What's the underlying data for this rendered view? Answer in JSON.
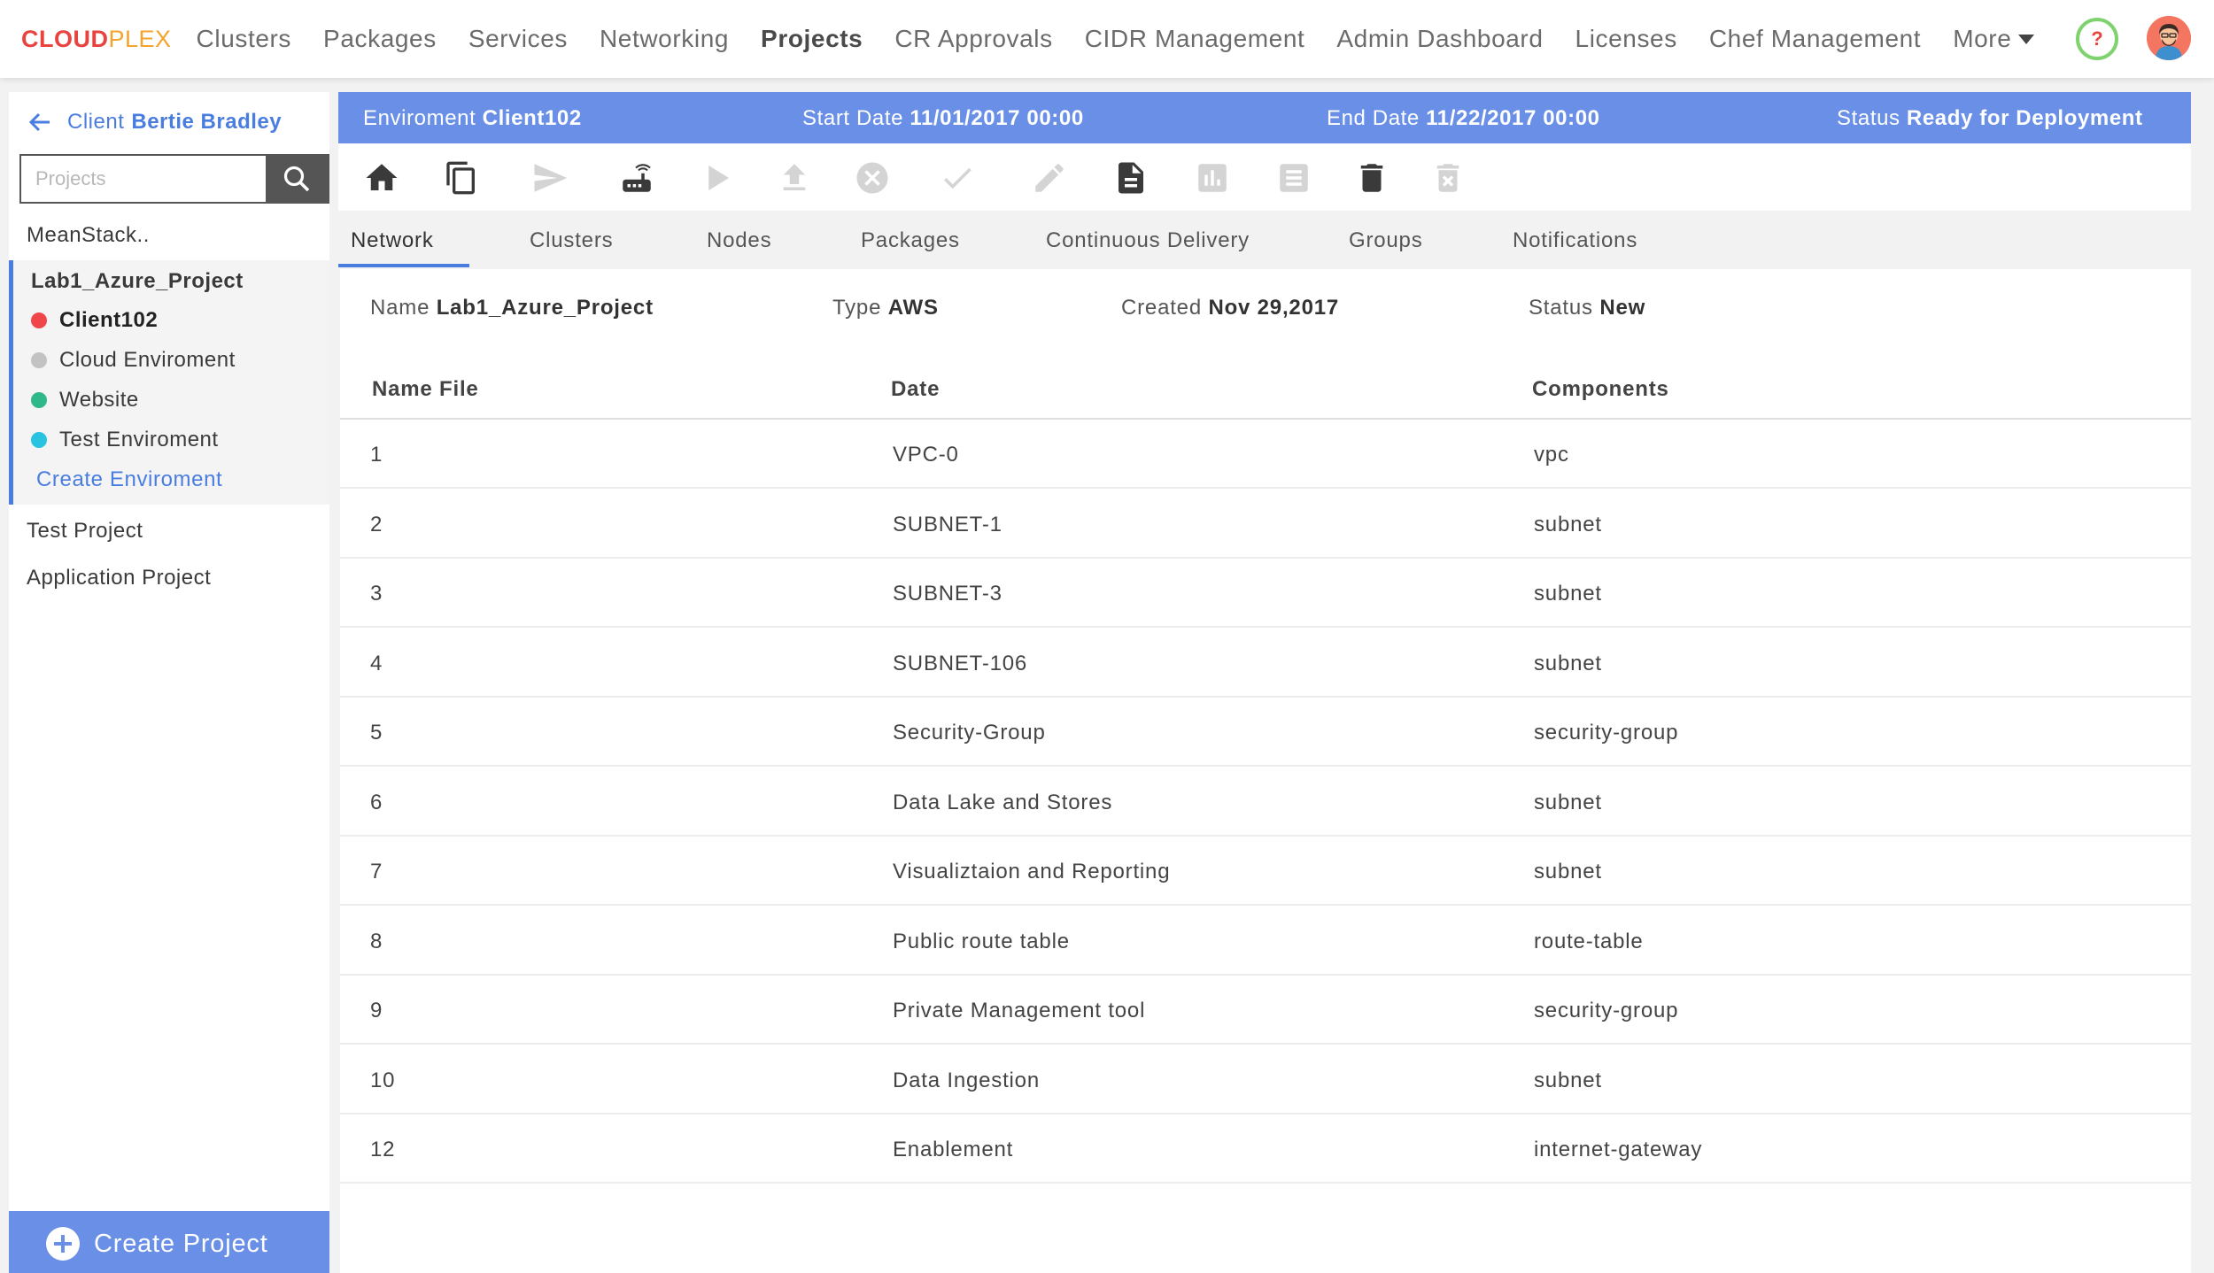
{
  "app": {
    "logo_part1": "CLOUD",
    "logo_part2": "PLEX"
  },
  "topnav": {
    "items": [
      {
        "label": "Clusters"
      },
      {
        "label": "Packages"
      },
      {
        "label": "Services"
      },
      {
        "label": "Networking"
      },
      {
        "label": "Projects",
        "active": true
      },
      {
        "label": "CR Approvals"
      },
      {
        "label": "CIDR Management"
      },
      {
        "label": "Admin Dashboard"
      },
      {
        "label": "Licenses"
      },
      {
        "label": "Chef Management"
      }
    ],
    "more_label": "More",
    "help_label": "?"
  },
  "sidebar": {
    "client_prefix": "Client",
    "client_name": "Bertie Bradley",
    "search_placeholder": "Projects",
    "projects_top": [
      "MeanStack.."
    ],
    "current_project": "Lab1_Azure_Project",
    "environments": [
      {
        "label": "Client102",
        "color": "#f0464a",
        "active": true
      },
      {
        "label": "Cloud Enviroment",
        "color": "#c2c2c2"
      },
      {
        "label": "Website",
        "color": "#2fb889"
      },
      {
        "label": "Test Enviroment",
        "color": "#27c3e0"
      }
    ],
    "create_env_label": "Create Enviroment",
    "projects_bottom": [
      "Test Project",
      "Application Project"
    ],
    "create_project_label": "Create Project"
  },
  "env_header": {
    "env_label": "Enviroment",
    "env_value": "Client102",
    "start_label": "Start Date",
    "start_value": "11/01/2017 00:00",
    "end_label": "End Date",
    "end_value": "11/22/2017 00:00",
    "status_label": "Status",
    "status_value": "Ready for Deployment"
  },
  "toolbar": {
    "icons": [
      "home-icon",
      "copy-icon",
      "send-icon",
      "router-icon",
      "play-icon",
      "upload-icon",
      "cancel-icon",
      "check-icon",
      "edit-icon",
      "document-icon",
      "chart-icon",
      "list-icon",
      "delete-icon",
      "delete-x-icon"
    ]
  },
  "tabs": [
    {
      "label": "Network",
      "active": true
    },
    {
      "label": "Clusters"
    },
    {
      "label": "Nodes"
    },
    {
      "label": "Packages"
    },
    {
      "label": "Continuous Delivery"
    },
    {
      "label": "Groups"
    },
    {
      "label": "Notifications"
    }
  ],
  "project_meta": {
    "name_label": "Name",
    "name_value": "Lab1_Azure_Project",
    "type_label": "Type",
    "type_value": "AWS",
    "created_label": "Created",
    "created_value": "Nov 29,2017",
    "status_label": "Status",
    "status_value": "New"
  },
  "table": {
    "columns": [
      "Name File",
      "Date",
      "Components"
    ],
    "rows": [
      [
        "1",
        "VPC-0",
        "vpc"
      ],
      [
        "2",
        "SUBNET-1",
        "subnet"
      ],
      [
        "3",
        "SUBNET-3",
        "subnet"
      ],
      [
        "4",
        "SUBNET-106",
        "subnet"
      ],
      [
        "5",
        "Security-Group",
        "security-group"
      ],
      [
        "6",
        "Data Lake and Stores",
        "subnet"
      ],
      [
        "7",
        "Visualiztaion and Reporting",
        "subnet"
      ],
      [
        "8",
        "Public route table",
        "route-table"
      ],
      [
        "9",
        "Private Management tool",
        "security-group"
      ],
      [
        "10",
        "Data Ingestion",
        "subnet"
      ],
      [
        "12",
        "Enablement",
        "internet-gateway"
      ]
    ]
  }
}
